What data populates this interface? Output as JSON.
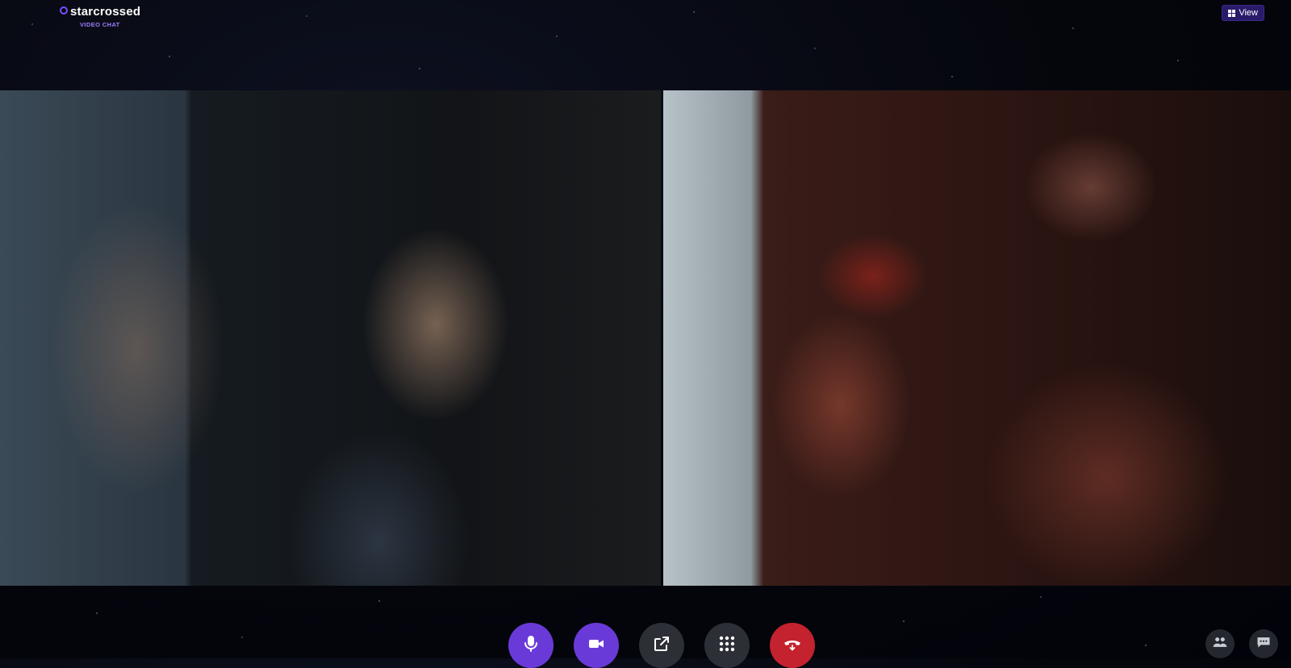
{
  "app": {
    "brand_name": "starcrossed",
    "brand_sub": "VIDEO CHAT"
  },
  "header": {
    "view_label": "View"
  },
  "colors": {
    "accent": "#6a3ad8",
    "end_call": "#c4222e",
    "control_gray": "#2c2f36"
  },
  "controls": [
    {
      "name": "mic-button",
      "icon": "microphone-icon"
    },
    {
      "name": "camera-button",
      "icon": "video-camera-icon"
    },
    {
      "name": "share-button",
      "icon": "external-link-icon"
    },
    {
      "name": "apps-button",
      "icon": "grid-dots-icon"
    },
    {
      "name": "end-call-button",
      "icon": "hang-up-icon"
    }
  ],
  "side_controls": [
    {
      "name": "participants-button",
      "icon": "people-icon"
    },
    {
      "name": "chat-button",
      "icon": "chat-bubble-icon"
    }
  ]
}
